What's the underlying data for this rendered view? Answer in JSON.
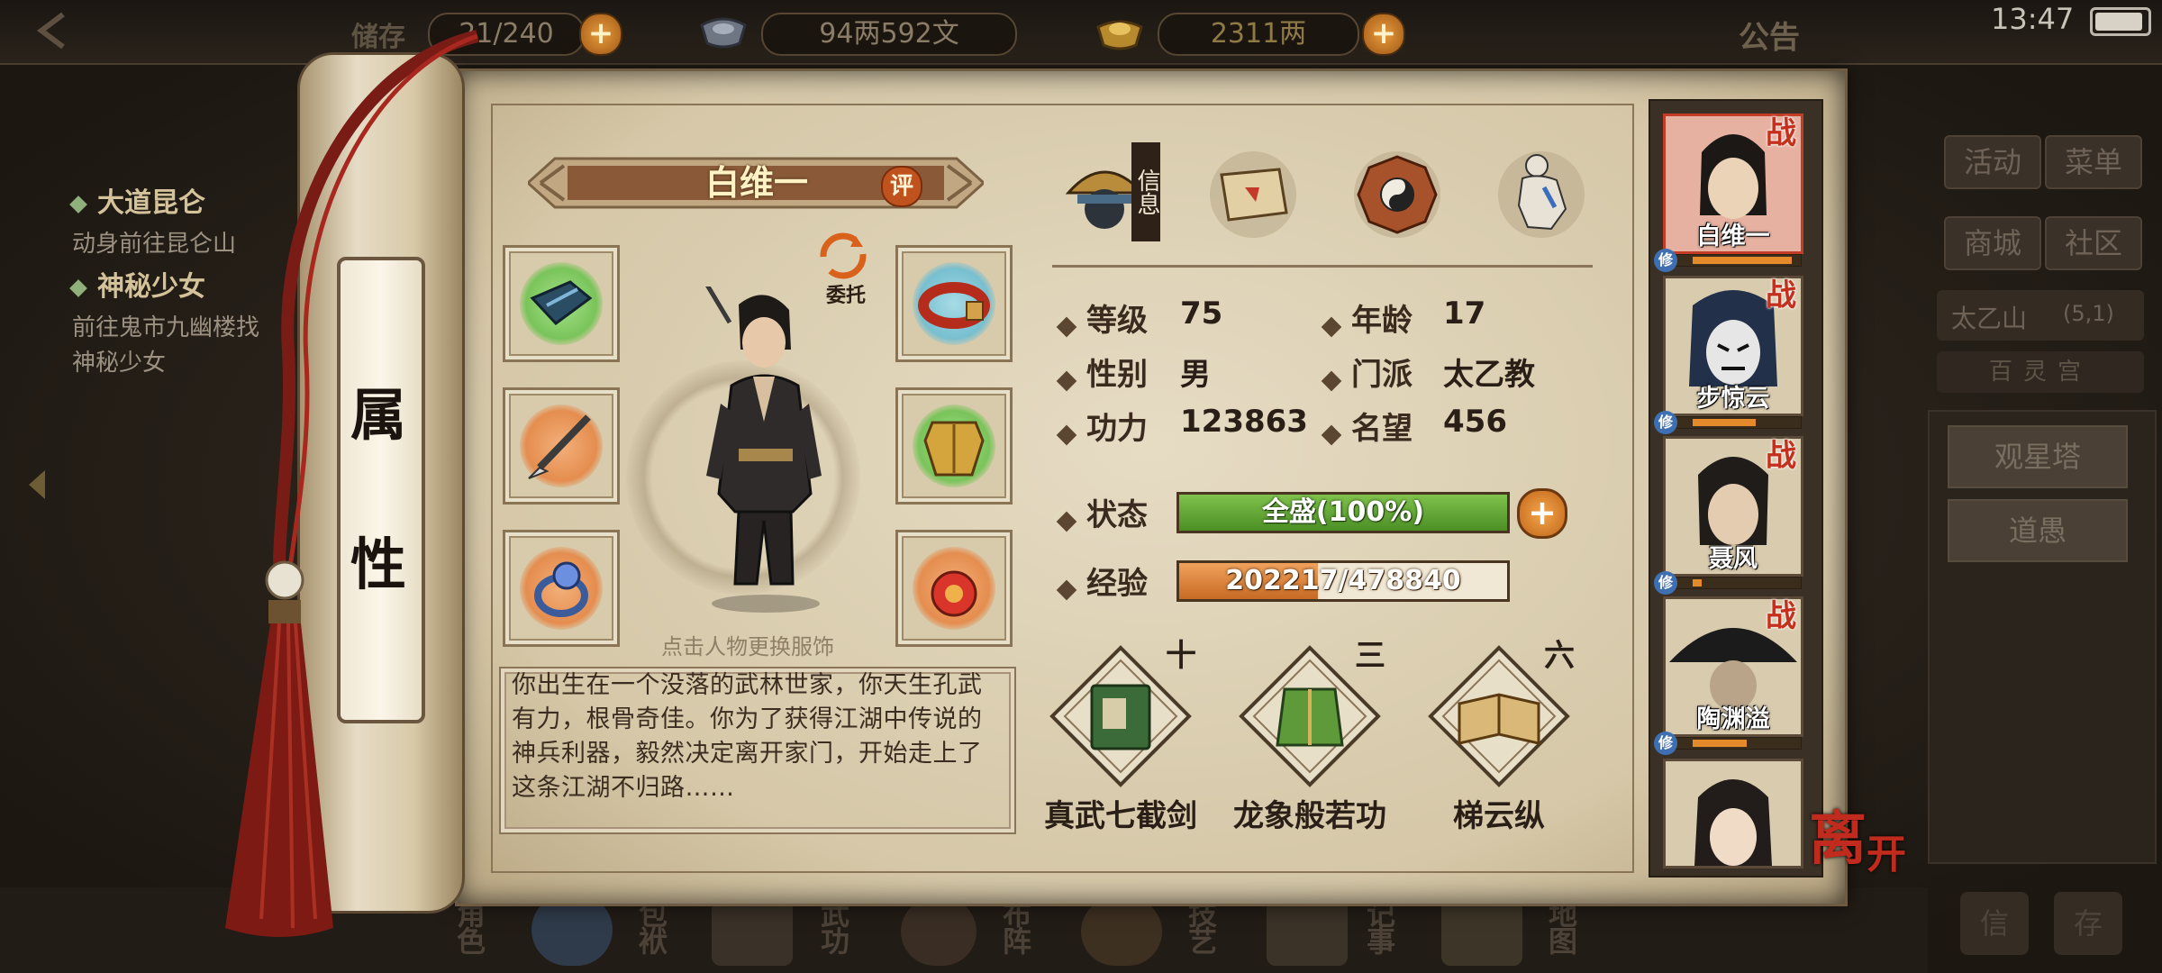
{
  "topbar": {
    "storage_label": "储存",
    "storage_value": "21/240",
    "money_value": "94两592文",
    "ingot_value": "2311两",
    "notice_label": "公告",
    "time": "13:47"
  },
  "quests": [
    {
      "title": "大道昆仑",
      "desc": [
        "动身前往昆仑山"
      ]
    },
    {
      "title": "神秘少女",
      "desc": [
        "前往鬼市九幽楼找",
        "神秘少女"
      ]
    }
  ],
  "right_menu": {
    "buttons": [
      "活动",
      "菜单",
      "商城",
      "社区"
    ],
    "location": "太乙山",
    "coords": "(5,1)",
    "zone": "百灵宫",
    "places": [
      "观星塔",
      "道愚"
    ],
    "bottom": [
      "信",
      "存"
    ]
  },
  "scroll_tab": [
    "属",
    "性"
  ],
  "character": {
    "name": "白维一",
    "rate_badge": "评",
    "commission": "委托",
    "change_outfit_hint": "点击人物更换服饰",
    "story": "你出生在一个没落的武林世家，你天生孔武有力，根骨奇佳。你为了获得江湖中传说的神兵利器，毅然决定离开家门，开始走上了这条江湖不归路……"
  },
  "tabs": [
    {
      "name": "info-tab",
      "label": "信息",
      "icon": "hat-icon"
    },
    {
      "name": "scroll-tab",
      "label": "",
      "icon": "scroll-map-icon"
    },
    {
      "name": "bagua-tab",
      "label": "",
      "icon": "bagua-icon"
    },
    {
      "name": "meridian-tab",
      "label": "",
      "icon": "body-icon"
    }
  ],
  "stats": {
    "level_label": "等级",
    "level": "75",
    "age_label": "年龄",
    "age": "17",
    "gender_label": "性别",
    "gender": "男",
    "sect_label": "门派",
    "sect": "太乙教",
    "power_label": "功力",
    "power": "123863",
    "fame_label": "名望",
    "fame": "456",
    "status_label": "状态",
    "status": "全盛(100%)",
    "exp_label": "经验",
    "exp": "202217/478840",
    "exp_fraction": 0.4223
  },
  "skills": [
    {
      "level": "十",
      "name": "真武七截剑",
      "icon": "green-book-icon"
    },
    {
      "level": "三",
      "name": "龙象般若功",
      "icon": "green-robe-icon"
    },
    {
      "level": "六",
      "name": "梯云纵",
      "icon": "open-book-icon"
    }
  ],
  "party": [
    {
      "name": "白维一",
      "tag": "战",
      "xiu": "修"
    },
    {
      "name": "步惊云",
      "tag": "战",
      "xiu": "修"
    },
    {
      "name": "聂风",
      "tag": "战",
      "xiu": "修"
    },
    {
      "name": "陶渊溢",
      "tag": "战",
      "xiu": "修"
    },
    {
      "name": "",
      "tag": "",
      "xiu": ""
    }
  ],
  "leave_label": [
    "离",
    "开"
  ],
  "bottom_nav": [
    "角色",
    "包袱",
    "武功",
    "布阵",
    "技艺",
    "记事",
    "地图"
  ],
  "colors": {
    "parchment": "#d5c7a7",
    "status_green": "#5fa534",
    "exp_orange": "#d47a30",
    "war_red": "#c4301e"
  }
}
